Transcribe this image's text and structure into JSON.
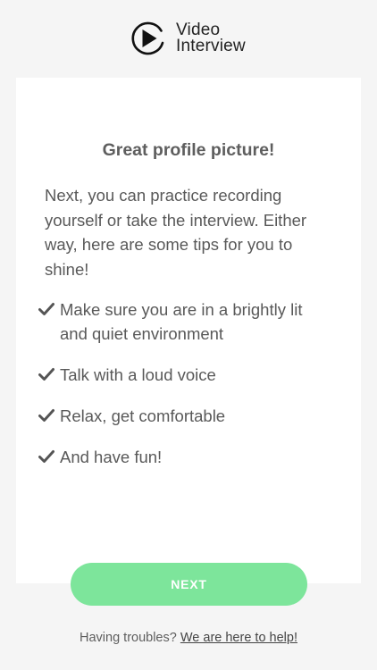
{
  "logo": {
    "line1": "Video",
    "line2": "Interview",
    "icon": "play-circle-icon"
  },
  "card": {
    "headline": "Great profile picture!",
    "intro": "Next, you can practice recording yourself or take the interview. Either way, here are some tips for you to shine!",
    "tips": [
      "Make sure you are in a brightly lit and quiet environment",
      "Talk with a loud voice",
      "Relax, get comfortable",
      "And have fun!"
    ],
    "tip_icon": "checkmark-icon"
  },
  "next_button": {
    "label": "NEXT",
    "color": "#7de59b"
  },
  "help": {
    "prompt": "Having troubles?",
    "link": "We are here to help!"
  }
}
